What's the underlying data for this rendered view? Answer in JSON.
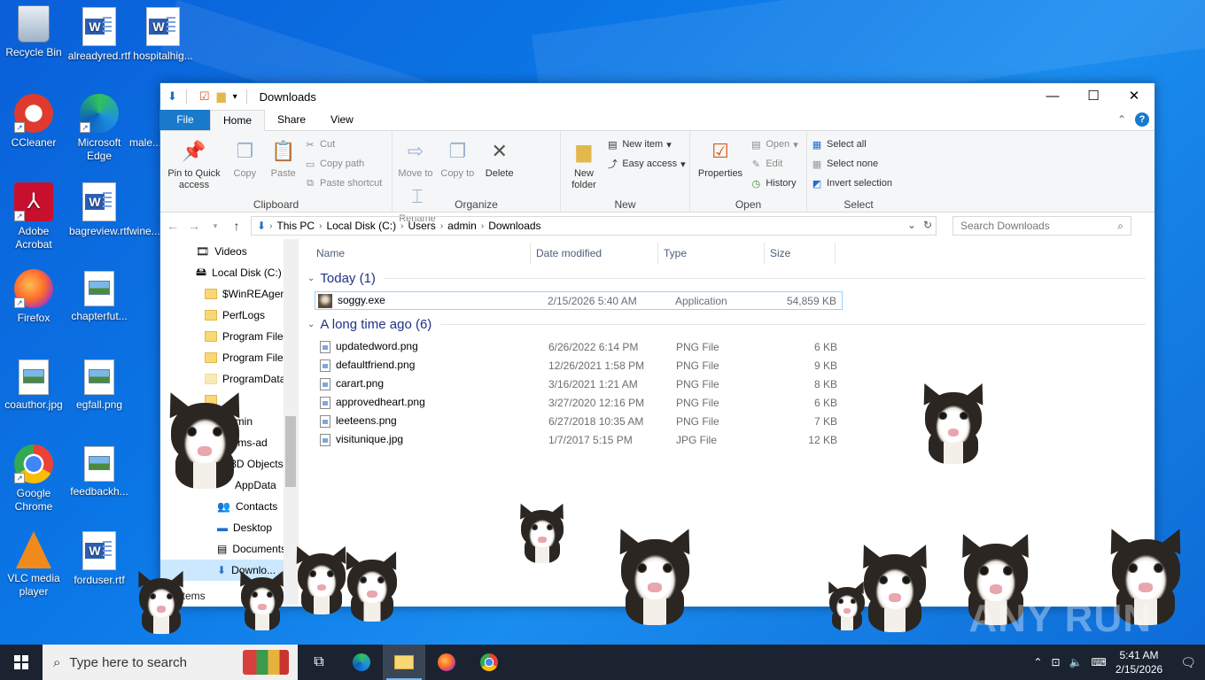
{
  "desktop": {
    "icons": [
      {
        "label": "Recycle Bin"
      },
      {
        "label": "alreadyred.rtf"
      },
      {
        "label": "hospitalhig..."
      },
      {
        "label": "CCleaner"
      },
      {
        "label": "Microsoft Edge"
      },
      {
        "label": "male..."
      },
      {
        "label": "Adobe Acrobat"
      },
      {
        "label": "bagreview.rtf"
      },
      {
        "label": "wine..."
      },
      {
        "label": "Firefox"
      },
      {
        "label": "chapterfut..."
      },
      {
        "label": "coauthor.jpg"
      },
      {
        "label": "egfall.png"
      },
      {
        "label": "Google Chrome"
      },
      {
        "label": "feedbackh..."
      },
      {
        "label": "VLC media player"
      },
      {
        "label": "forduser.rtf"
      }
    ]
  },
  "window": {
    "title": "Downloads",
    "controls": {
      "minimize": "—",
      "maximize": "☐",
      "close": "✕"
    },
    "tabs": {
      "file": "File",
      "home": "Home",
      "share": "Share",
      "view": "View"
    },
    "ribbon": {
      "clipboard": {
        "pin": "Pin to Quick access",
        "copy": "Copy",
        "paste": "Paste",
        "cut": "Cut",
        "copy_path": "Copy path",
        "paste_shortcut": "Paste shortcut",
        "label": "Clipboard"
      },
      "organize": {
        "move_to": "Move to",
        "copy_to": "Copy to",
        "delete": "Delete",
        "rename": "Rename",
        "label": "Organize"
      },
      "new": {
        "new_folder": "New folder",
        "new_item": "New item",
        "easy_access": "Easy access",
        "label": "New"
      },
      "open": {
        "properties": "Properties",
        "open": "Open",
        "edit": "Edit",
        "history": "History",
        "label": "Open"
      },
      "select": {
        "select_all": "Select all",
        "select_none": "Select none",
        "invert": "Invert selection",
        "label": "Select"
      }
    },
    "address": {
      "crumbs": [
        "This PC",
        "Local Disk (C:)",
        "Users",
        "admin",
        "Downloads"
      ],
      "search_placeholder": "Search Downloads"
    },
    "nav_tree": [
      {
        "label": "Videos"
      },
      {
        "label": "Local Disk (C:)"
      },
      {
        "label": "$WinREAgent"
      },
      {
        "label": "PerfLogs"
      },
      {
        "label": "Program Files"
      },
      {
        "label": "Program Files"
      },
      {
        "label": "ProgramData"
      },
      {
        "label": ""
      },
      {
        "label": "dmin"
      },
      {
        "label": ".ms-ad"
      },
      {
        "label": "3D Objects"
      },
      {
        "label": "AppData"
      },
      {
        "label": "Contacts"
      },
      {
        "label": "Desktop"
      },
      {
        "label": "Documents"
      },
      {
        "label": "Downlo..."
      }
    ],
    "columns": {
      "name": "Name",
      "date": "Date modified",
      "type": "Type",
      "size": "Size"
    },
    "groups": [
      {
        "title": "Today (1)",
        "files": [
          {
            "name": "soggy.exe",
            "date": "2/15/2026 5:40 AM",
            "type": "Application",
            "size": "54,859 KB"
          }
        ]
      },
      {
        "title": "A long time ago (6)",
        "files": [
          {
            "name": "updatedword.png",
            "date": "6/26/2022 6:14 PM",
            "type": "PNG File",
            "size": "6 KB"
          },
          {
            "name": "defaultfriend.png",
            "date": "12/26/2021 1:58 PM",
            "type": "PNG File",
            "size": "9 KB"
          },
          {
            "name": "carart.png",
            "date": "3/16/2021 1:21 AM",
            "type": "PNG File",
            "size": "8 KB"
          },
          {
            "name": "approvedheart.png",
            "date": "3/27/2020 12:16 PM",
            "type": "PNG File",
            "size": "6 KB"
          },
          {
            "name": "leeteens.png",
            "date": "6/27/2018 10:35 AM",
            "type": "PNG File",
            "size": "7 KB"
          },
          {
            "name": "visitunique.jpg",
            "date": "1/7/2017 5:15 PM",
            "type": "JPG File",
            "size": "12 KB"
          }
        ]
      }
    ],
    "status": "items"
  },
  "taskbar": {
    "search_placeholder": "Type here to search",
    "time": "5:41 AM",
    "date": "2/15/2026"
  },
  "watermark": "ANY RUN",
  "colors": {
    "accent": "#1979ca",
    "desktop": "#0b77e6",
    "taskbar": "#1b2330"
  }
}
